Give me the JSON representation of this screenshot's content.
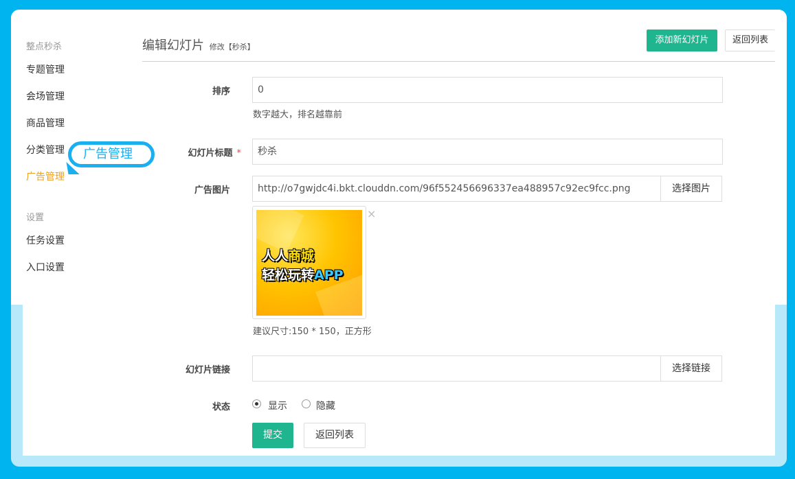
{
  "sidebar": {
    "group1": "整点秒杀",
    "items": [
      {
        "label": "专题管理",
        "active": false
      },
      {
        "label": "会场管理",
        "active": false
      },
      {
        "label": "商品管理",
        "active": false
      },
      {
        "label": "分类管理",
        "active": false
      },
      {
        "label": "广告管理",
        "active": true
      }
    ],
    "group2": "设置",
    "items2": [
      {
        "label": "任务设置"
      },
      {
        "label": "入口设置"
      }
    ]
  },
  "callout": "广告管理",
  "header": {
    "title": "编辑幻灯片",
    "subtitle": "修改【秒杀】",
    "add_button": "添加新幻灯片",
    "back_button": "返回列表"
  },
  "form": {
    "sort": {
      "label": "排序",
      "value": "0",
      "help": "数字越大，排名越靠前"
    },
    "title": {
      "label": "幻灯片标题",
      "required_mark": "*",
      "value": "秒杀"
    },
    "image": {
      "label": "广告图片",
      "value": "http://o7gwjdc4i.bkt.clouddn.com/96f552456696337ea488957c92ec9fcc.png",
      "button": "选择图片",
      "help": "建议尺寸:150 * 150，正方形",
      "preview_line1_a": "人人",
      "preview_line1_b": "商城",
      "preview_line2_a": "轻松玩转",
      "preview_line2_b": "APP",
      "remove_icon": "×"
    },
    "link": {
      "label": "幻灯片链接",
      "value": "",
      "button": "选择链接"
    },
    "status": {
      "label": "状态",
      "options": [
        {
          "label": "显示",
          "checked": true
        },
        {
          "label": "隐藏",
          "checked": false
        }
      ]
    },
    "submit": "提交",
    "back": "返回列表"
  },
  "colors": {
    "accent": "#1fb58f",
    "active_menu": "#f0a020",
    "callout": "#1ab0f0",
    "background": "#00b4f0"
  }
}
